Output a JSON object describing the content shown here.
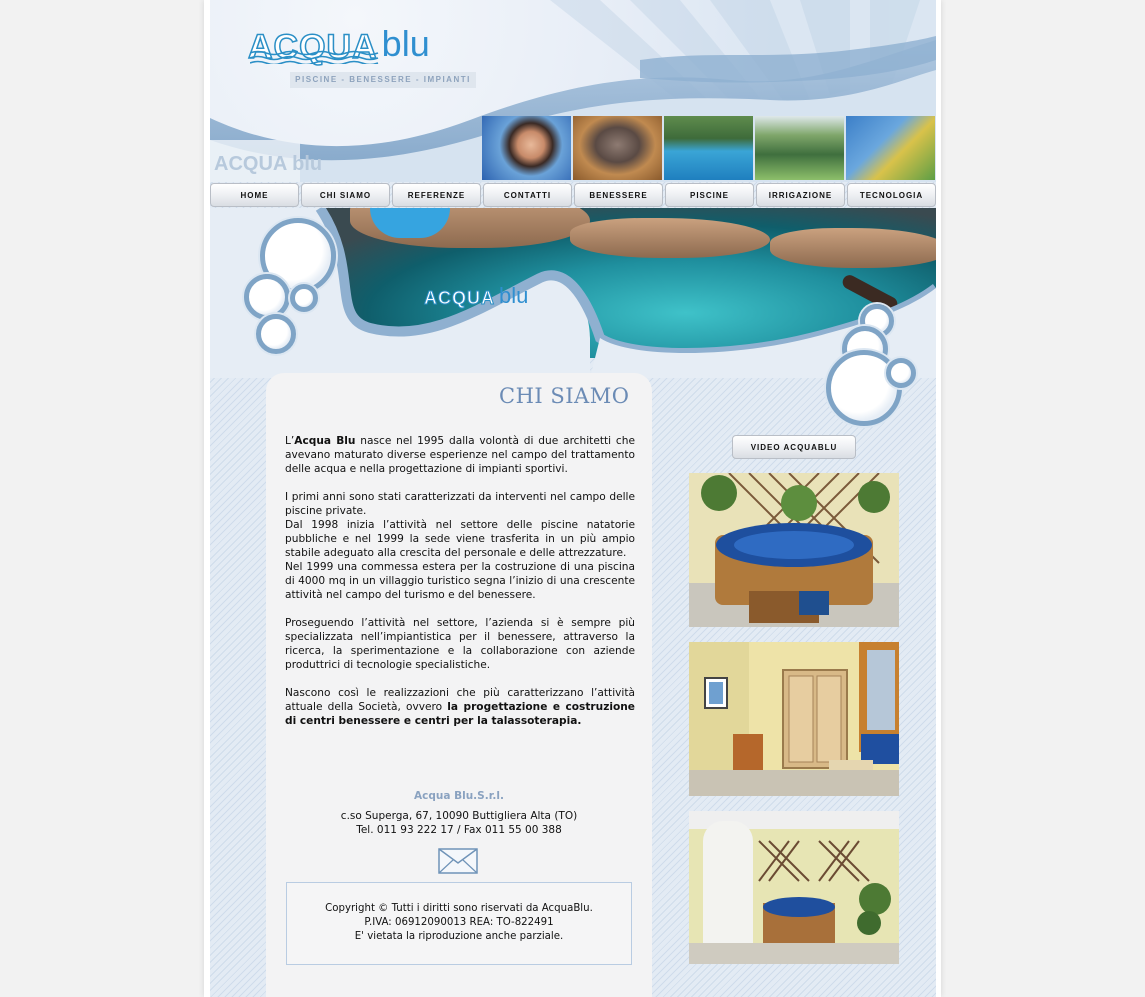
{
  "header": {
    "logo_main": "ACQUA",
    "logo_sub": "blu",
    "tagline": "PISCINE - BENESSERE - IMPIANTI"
  },
  "nav": [
    {
      "label": "HOME"
    },
    {
      "label": "CHI SIAMO"
    },
    {
      "label": "REFERENZE"
    },
    {
      "label": "CONTATTI"
    },
    {
      "label": "BENESSERE"
    },
    {
      "label": "PISCINE"
    },
    {
      "label": "IRRIGAZIONE"
    },
    {
      "label": "TECNOLOGIA"
    }
  ],
  "banner": {
    "logo_main": "ACQUA",
    "logo_sub": "blu"
  },
  "main": {
    "title": "CHI SIAMO",
    "p1_lead": "L’",
    "p1_brand": "Acqua Blu",
    "p1_rest": " nasce nel 1995 dalla volontà di due architetti che avevano maturato diverse esperienze nel campo del trattamento delle acqua e nella progettazione di impianti sportivi.",
    "p2": "I primi anni sono stati caratterizzati da interventi nel campo delle piscine private.",
    "p3": "Dal 1998 inizia l’attività nel settore delle piscine natatorie pubbliche e nel 1999 la sede viene trasferita in un più ampio stabile adeguato alla crescita del personale e delle attrezzature.",
    "p4": "Nel 1999 una commessa estera per la costruzione di una piscina di 4000 mq in un villaggio turistico segna l’inizio di una crescente attività nel campo del turismo e del benessere.",
    "p5": "Proseguendo l’attività nel settore, l’azienda si è sempre più specializzata nell’impiantistica per il benessere, attraverso la ricerca, la sperimentazione e la collaborazione con aziende produttrici di tecnologie specialistiche.",
    "p6_lead": "Nascono così le realizzazioni che più caratterizzano l’attività attuale della Società, ovvero ",
    "p6_bold": "la progettazione e costruzione di centri benessere e centri per la talassoterapia."
  },
  "footer": {
    "company": "Acqua Blu.S.r.l.",
    "address": "c.so Superga, 67, 10090 Buttigliera Alta (TO)",
    "phone": "Tel. 011 93 222 17 / Fax 011 55 00 388",
    "copyright": "Copyright © Tutti i diritti sono riservati da AcquaBlu.",
    "piva": "P.IVA: 06912090013 REA: TO-822491",
    "notice": "E' vietata la riproduzione anche parziale."
  },
  "sidebar": {
    "video_label": "VIDEO ACQUABLU"
  },
  "icons": {
    "mail": "envelope-icon"
  },
  "colors": {
    "accent": "#2f8fd0",
    "title": "#6b8bb5",
    "company": "#8aa2c0"
  }
}
